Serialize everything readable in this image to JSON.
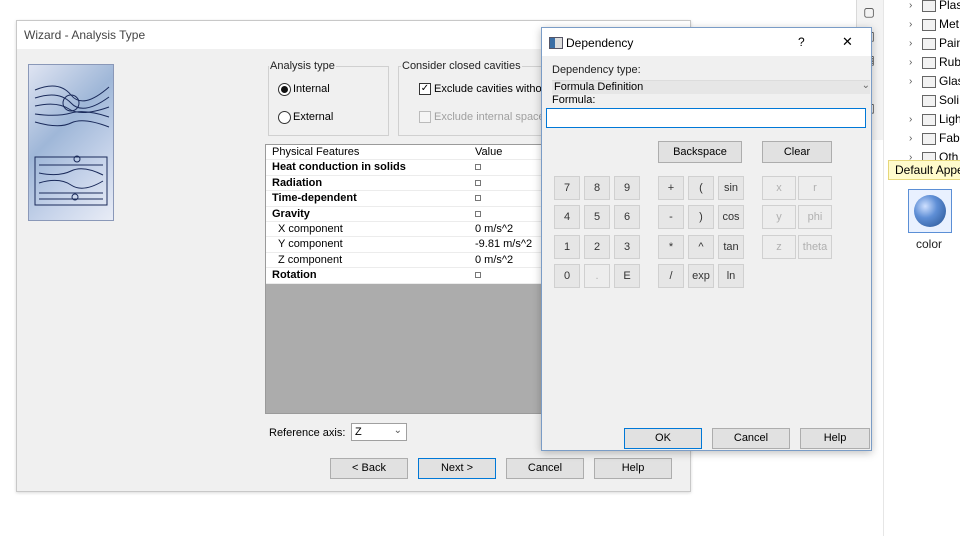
{
  "right_panel": {
    "tree_items": [
      "Plas",
      "Met",
      "Pain",
      "Rub",
      "Glas",
      "Soli",
      "Ligh",
      "Fabr",
      "Oth"
    ],
    "default_appearance_label": "Default Appe",
    "swatch_label": "color"
  },
  "wizard": {
    "title": "Wizard - Analysis Type",
    "analysis_type": {
      "label": "Analysis type",
      "options": [
        "Internal",
        "External"
      ],
      "selected": "Internal"
    },
    "closed_cavities": {
      "label": "Consider closed cavities",
      "exclude_cavities_label": "Exclude cavities withou",
      "exclude_cavities_checked": true,
      "exclude_internal_label": "Exclude internal space",
      "exclude_internal_checked": false
    },
    "physical_features": {
      "headers": [
        "Physical Features",
        "Value"
      ],
      "rows": [
        {
          "name": "Heat conduction in solids",
          "value": "",
          "bold": true,
          "checkbox": true
        },
        {
          "name": "Radiation",
          "value": "",
          "bold": true,
          "checkbox": true
        },
        {
          "name": "Time-dependent",
          "value": "",
          "bold": true,
          "checkbox": true
        },
        {
          "name": "Gravity",
          "value": "",
          "bold": true,
          "checkbox": true
        },
        {
          "name": "X component",
          "value": "0 m/s^2",
          "bold": false,
          "checkbox": false
        },
        {
          "name": "Y component",
          "value": "-9.81 m/s^2",
          "bold": false,
          "checkbox": false
        },
        {
          "name": "Z component",
          "value": "0 m/s^2",
          "bold": false,
          "checkbox": false
        },
        {
          "name": "Rotation",
          "value": "",
          "bold": true,
          "checkbox": true
        }
      ]
    },
    "reference_axis": {
      "label": "Reference axis:",
      "value": "Z"
    },
    "buttons": {
      "back": "< Back",
      "next": "Next >",
      "cancel": "Cancel",
      "help": "Help"
    }
  },
  "dependency": {
    "title": "Dependency",
    "question": "?",
    "close": "✕",
    "dependency_type_label": "Dependency type:",
    "dependency_type_value": "Formula Definition",
    "formula_label": "Formula:",
    "formula_value": "",
    "backspace": "Backspace",
    "clear": "Clear",
    "keypad": [
      [
        "7",
        "8",
        "9"
      ],
      [
        "4",
        "5",
        "6"
      ],
      [
        "1",
        "2",
        "3"
      ],
      [
        "0",
        ".",
        "E"
      ]
    ],
    "ops": [
      [
        "+",
        "(",
        "sin"
      ],
      [
        "-",
        ")",
        "cos"
      ],
      [
        "*",
        "^",
        "tan"
      ],
      [
        "/",
        "exp",
        "ln"
      ]
    ],
    "vars": [
      [
        "x",
        "r"
      ],
      [
        "y",
        "phi"
      ],
      [
        "z",
        "theta"
      ]
    ],
    "ok": "OK",
    "cancel": "Cancel",
    "help": "Help"
  }
}
